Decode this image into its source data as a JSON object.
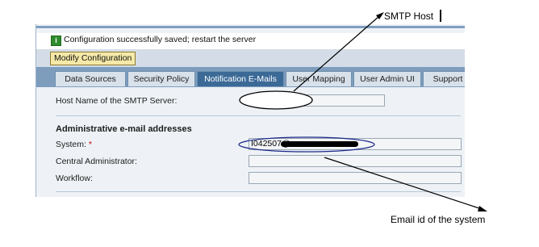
{
  "message": {
    "icon": "info-icon",
    "text": "Configuration successfully saved; restart the server"
  },
  "toolbar": {
    "modify_label": "Modify Configuration"
  },
  "tabs": [
    {
      "label": "Data Sources"
    },
    {
      "label": "Security Policy"
    },
    {
      "label": "Notification E-Mails",
      "active": true
    },
    {
      "label": "User Mapping"
    },
    {
      "label": "User Admin UI"
    },
    {
      "label": "Support"
    }
  ],
  "form": {
    "smtp_label": "Host Name of the SMTP Server:",
    "smtp_value": "",
    "admin_section_title": "Administrative e-mail addresses",
    "system_label": "System:",
    "required_mark": "*",
    "system_value": "I042507@",
    "central_admin_label": "Central Administrator:",
    "central_admin_value": "",
    "workflow_label": "Workflow:",
    "workflow_value": ""
  },
  "annotations": {
    "smtp_host": "SMTP Host",
    "email_id": "Email id of the system"
  },
  "colors": {
    "annotation_ellipse": "#1c2a8a",
    "active_tab": "#3c6a97"
  }
}
